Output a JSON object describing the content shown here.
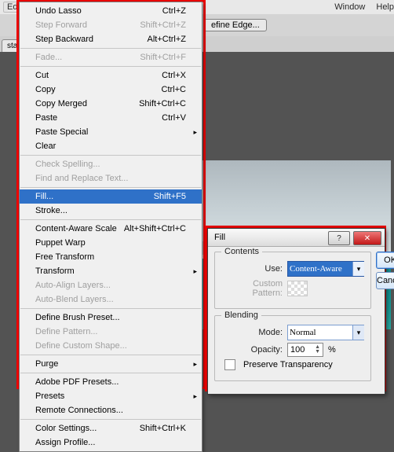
{
  "menubar": {
    "edit": "Edit",
    "window": "Window",
    "help": "Help"
  },
  "toolbar": {
    "refine": "efine Edge..."
  },
  "tab": {
    "label": "sta-Beach"
  },
  "edit_menu": {
    "undo": "Undo Lasso",
    "undo_sc": "Ctrl+Z",
    "step_fwd": "Step Forward",
    "step_fwd_sc": "Shift+Ctrl+Z",
    "step_back": "Step Backward",
    "step_back_sc": "Alt+Ctrl+Z",
    "fade": "Fade...",
    "fade_sc": "Shift+Ctrl+F",
    "cut": "Cut",
    "cut_sc": "Ctrl+X",
    "copy": "Copy",
    "copy_sc": "Ctrl+C",
    "copy_merged": "Copy Merged",
    "copy_merged_sc": "Shift+Ctrl+C",
    "paste": "Paste",
    "paste_sc": "Ctrl+V",
    "paste_special": "Paste Special",
    "clear": "Clear",
    "check_spelling": "Check Spelling...",
    "find_replace": "Find and Replace Text...",
    "fill": "Fill...",
    "fill_sc": "Shift+F5",
    "stroke": "Stroke...",
    "content_aware_scale": "Content-Aware Scale",
    "cas_sc": "Alt+Shift+Ctrl+C",
    "puppet_warp": "Puppet Warp",
    "free_transform": "Free Transform",
    "transform": "Transform",
    "auto_align": "Auto-Align Layers...",
    "auto_blend": "Auto-Blend Layers...",
    "define_brush": "Define Brush Preset...",
    "define_pattern": "Define Pattern...",
    "define_shape": "Define Custom Shape...",
    "purge": "Purge",
    "pdf_presets": "Adobe PDF Presets...",
    "presets": "Presets",
    "remote": "Remote Connections...",
    "color_settings": "Color Settings...",
    "color_settings_sc": "Shift+Ctrl+K",
    "assign_profile": "Assign Profile..."
  },
  "dialog": {
    "title": "Fill",
    "ok": "OK",
    "cancel": "Cancel",
    "contents_legend": "Contents",
    "use_label": "Use:",
    "use_value": "Content-Aware",
    "custom_pattern_label": "Custom Pattern:",
    "blending_legend": "Blending",
    "mode_label": "Mode:",
    "mode_value": "Normal",
    "opacity_label": "Opacity:",
    "opacity_value": "100",
    "opacity_pct": "%",
    "preserve_label": "Preserve Transparency"
  }
}
